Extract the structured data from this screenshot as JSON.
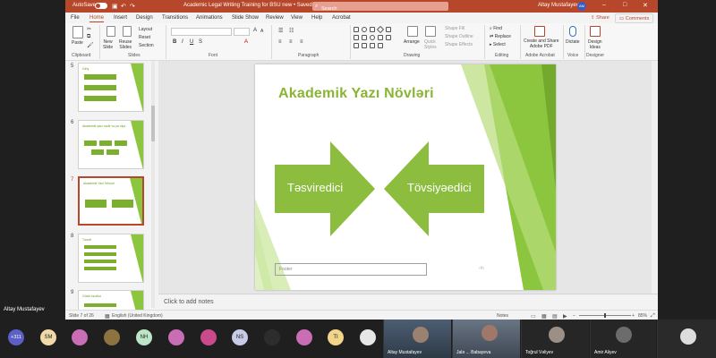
{
  "titlebar": {
    "autosave": "AutoSave",
    "doc_title": "Academic Legal Writing Training for BSU new  •  Saved",
    "search": "Search",
    "user": "Altay Mustafayev",
    "avatar": "AM"
  },
  "menu": [
    "File",
    "Home",
    "Insert",
    "Design",
    "Transitions",
    "Animations",
    "Slide Show",
    "Review",
    "View",
    "Help",
    "Acrobat"
  ],
  "menu_active": "Home",
  "share": "Share",
  "comments": "Comments",
  "ribbon": {
    "paste": "Paste",
    "new_slide": "New\nSlide",
    "reuse_slides": "Reuse\nSlides",
    "layout": "Layout",
    "reset": "Reset",
    "section": "Section",
    "arrange": "Arrange",
    "quick_styles": "Quick\nStyles",
    "shape_fill": "Shape Fill",
    "shape_outline": "Shape Outline",
    "shape_effects": "Shape Effects",
    "find": "Find",
    "replace": "Replace",
    "select": "Select",
    "create_share_pdf": "Create and Share\nAdobe PDF",
    "dictate": "Dictate",
    "design_ideas": "Design\nIdeas",
    "groups": [
      "Clipboard",
      "Slides",
      "Font",
      "Paragraph",
      "Drawing",
      "Editing",
      "Adobe Acrobat",
      "Voice",
      "Designer"
    ]
  },
  "thumbnails": [
    {
      "num": "5",
      "title": "Giriş"
    },
    {
      "num": "6",
      "title": "Akademik yazı nədir və ya niyə"
    },
    {
      "num": "7",
      "title": "Akademik Yazı Növləri"
    },
    {
      "num": "8",
      "title": "Təsviri"
    },
    {
      "num": "9",
      "title": "Güclü tərəflər"
    }
  ],
  "slide": {
    "title": "Akademik Yazı Növləri",
    "left_arrow": "Təsviredici",
    "right_arrow": "Tövsiyəedici",
    "footer_placeholder": "Footer",
    "colors": {
      "accent": "#8ab534",
      "arrow": "#8cbd3f"
    }
  },
  "notes_placeholder": "Click to add notes",
  "status": {
    "slide_of": "Slide 7 of 26",
    "language": "English (United Kingdom)",
    "notes": "Notes",
    "zoom": "85%"
  },
  "teams": {
    "presenter": "Altay Mustafayev",
    "overflow_count": "+311",
    "initials": [
      "SM",
      "NH",
      "NS",
      "TI"
    ],
    "tiles": [
      "Altay Mustafayev",
      "Jalə ... Babayeva",
      "Toğrul Vəliyev",
      "Amir Aliyev"
    ]
  }
}
